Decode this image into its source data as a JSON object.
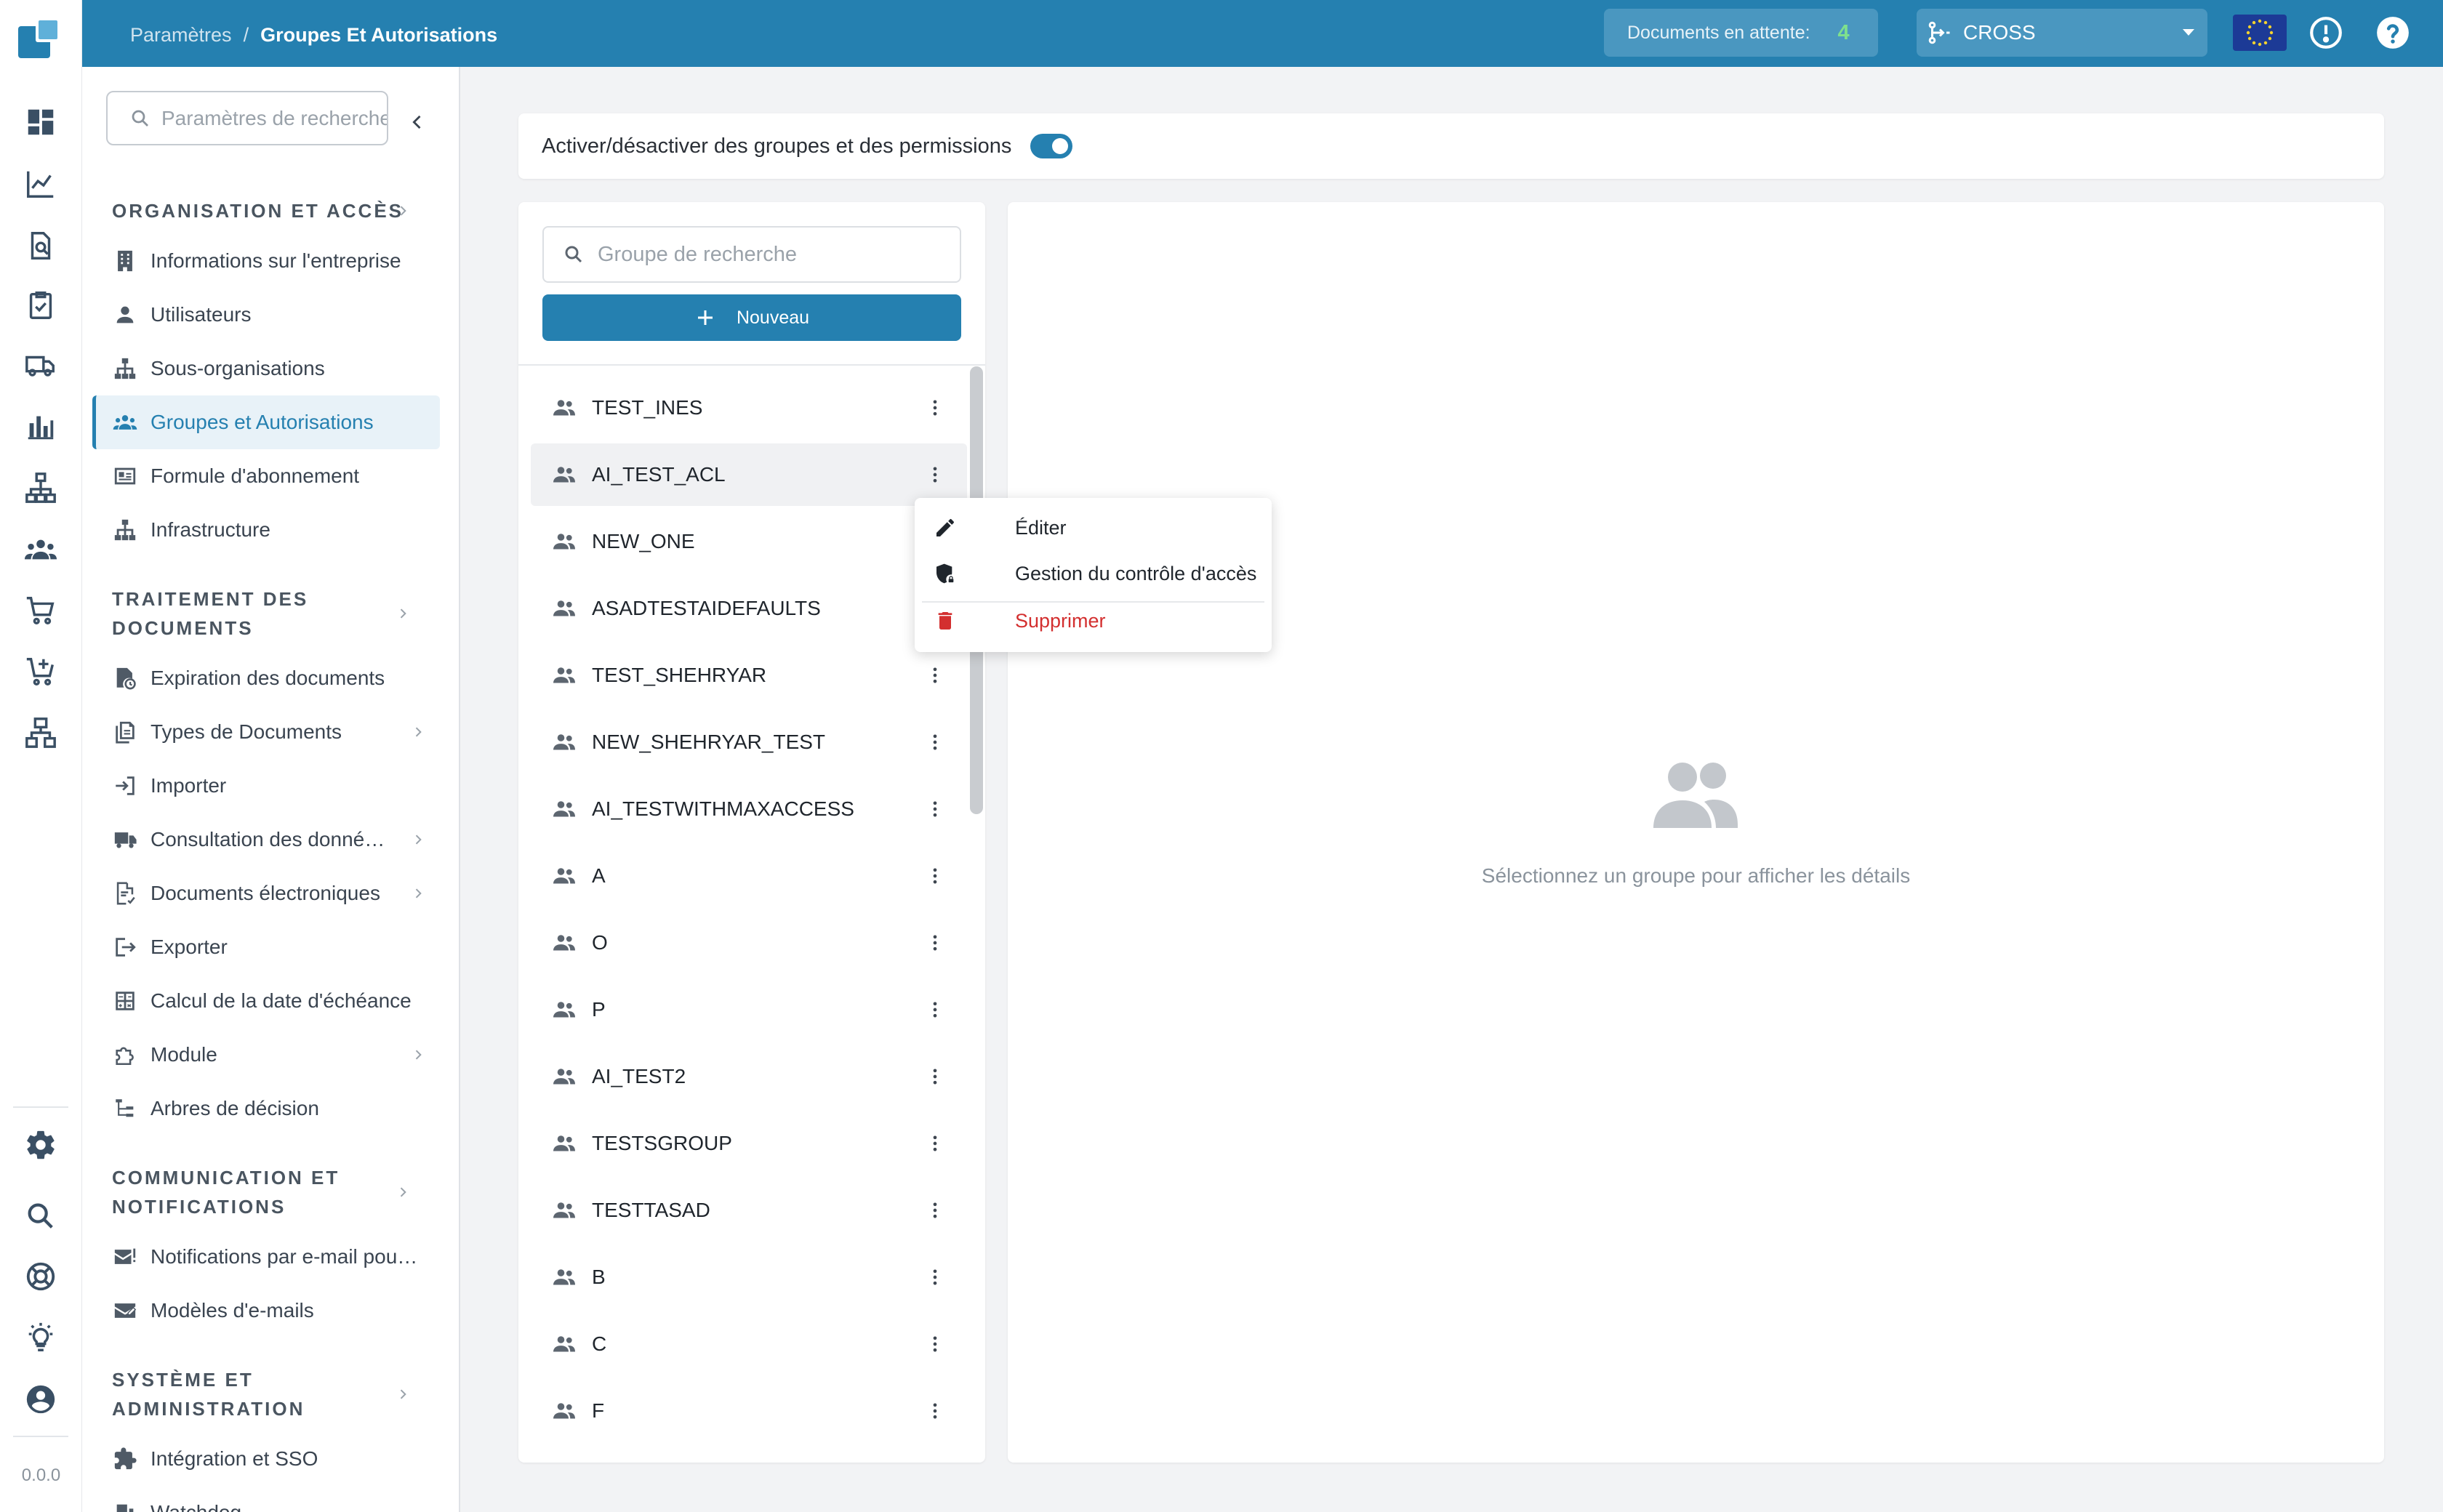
{
  "breadcrumb": {
    "parent": "Paramètres",
    "separator": "/",
    "current": "Groupes Et Autorisations"
  },
  "topbar": {
    "pending_label": "Documents en attente:",
    "pending_count": "4",
    "tenant": "CROSS",
    "icons": [
      "eu-flag-icon",
      "alert-circle-icon",
      "help-icon"
    ]
  },
  "rail": {
    "icons": [
      "dashboard-icon",
      "line-chart-icon",
      "document-search-icon",
      "checklist-icon",
      "truck-icon",
      "bar-chart-icon",
      "hierarchy-icon",
      "people-icon",
      "cart-icon",
      "cart-add-icon",
      "network-icon",
      "settings-icon",
      "search-icon",
      "lifebuoy-icon",
      "lightbulb-icon",
      "account-icon"
    ],
    "version": "0.0.0"
  },
  "settings_nav": {
    "search_placeholder": "Paramètres de recherche",
    "sections": [
      {
        "title": "ORGANISATION ET ACCÈS",
        "items": [
          {
            "label": "Informations sur l'entreprise",
            "icon": "building-icon"
          },
          {
            "label": "Utilisateurs",
            "icon": "user-icon"
          },
          {
            "label": "Sous-organisations",
            "icon": "org-tree-icon"
          },
          {
            "label": "Groupes et Autorisations",
            "icon": "group-icon",
            "active": true
          },
          {
            "label": "Formule d'abonnement",
            "icon": "id-card-icon"
          },
          {
            "label": "Infrastructure",
            "icon": "org-tree-icon"
          }
        ]
      },
      {
        "title": "TRAITEMENT DES DOCUMENTS",
        "items": [
          {
            "label": "Expiration des documents",
            "icon": "document-clock-icon"
          },
          {
            "label": "Types de Documents",
            "icon": "documents-icon",
            "has_children": true
          },
          {
            "label": "Importer",
            "icon": "import-icon"
          },
          {
            "label": "Consultation des donné…",
            "icon": "truck-icon",
            "has_children": true
          },
          {
            "label": "Documents électroniques",
            "icon": "edocument-icon",
            "has_children": true
          },
          {
            "label": "Exporter",
            "icon": "export-icon"
          },
          {
            "label": "Calcul de la date d'échéance",
            "icon": "calculator-icon"
          },
          {
            "label": "Module",
            "icon": "puzzle-icon",
            "has_children": true
          },
          {
            "label": "Arbres de décision",
            "icon": "decision-tree-icon"
          }
        ]
      },
      {
        "title": "COMMUNICATION ET NOTIFICATIONS",
        "items": [
          {
            "label": "Notifications par e-mail pou…",
            "icon": "mail-alert-icon"
          },
          {
            "label": "Modèles d'e-mails",
            "icon": "mail-template-icon"
          }
        ]
      },
      {
        "title": "SYSTÈME ET ADMINISTRATION",
        "items": [
          {
            "label": "Intégration et SSO",
            "icon": "extension-icon"
          },
          {
            "label": "Watchdog",
            "icon": "watchdog-icon"
          }
        ]
      }
    ]
  },
  "toggle_card": {
    "label": "Activer/désactiver des groupes et des permissions",
    "enabled": true
  },
  "groups_panel": {
    "search_placeholder": "Groupe de recherche",
    "new_button": "Nouveau",
    "groups": [
      "TEST_INES",
      "AI_TEST_ACL",
      "NEW_ONE",
      "ASADTESTAIDEFAULTS",
      "TEST_SHEHRYAR",
      "NEW_SHEHRYAR_TEST",
      "AI_TESTWITHMAXACCESS",
      "A",
      "O",
      "P",
      "AI_TEST2",
      "TESTSGROUP",
      "TESTTASAD",
      "B",
      "C",
      "F"
    ],
    "hovered_index": 1
  },
  "context_menu": {
    "items": [
      {
        "label": "Éditer",
        "icon": "pencil-icon"
      },
      {
        "label": "Gestion du contrôle d'accès",
        "icon": "shield-lock-icon"
      },
      {
        "label": "Supprimer",
        "icon": "trash-icon",
        "danger": true
      }
    ]
  },
  "detail": {
    "empty_text": "Sélectionnez un groupe pour afficher les détails"
  },
  "colors": {
    "primary": "#2580b0",
    "active_bg": "#e8f2f8",
    "danger": "#d32f2f",
    "pending_count": "#7ee08d"
  }
}
